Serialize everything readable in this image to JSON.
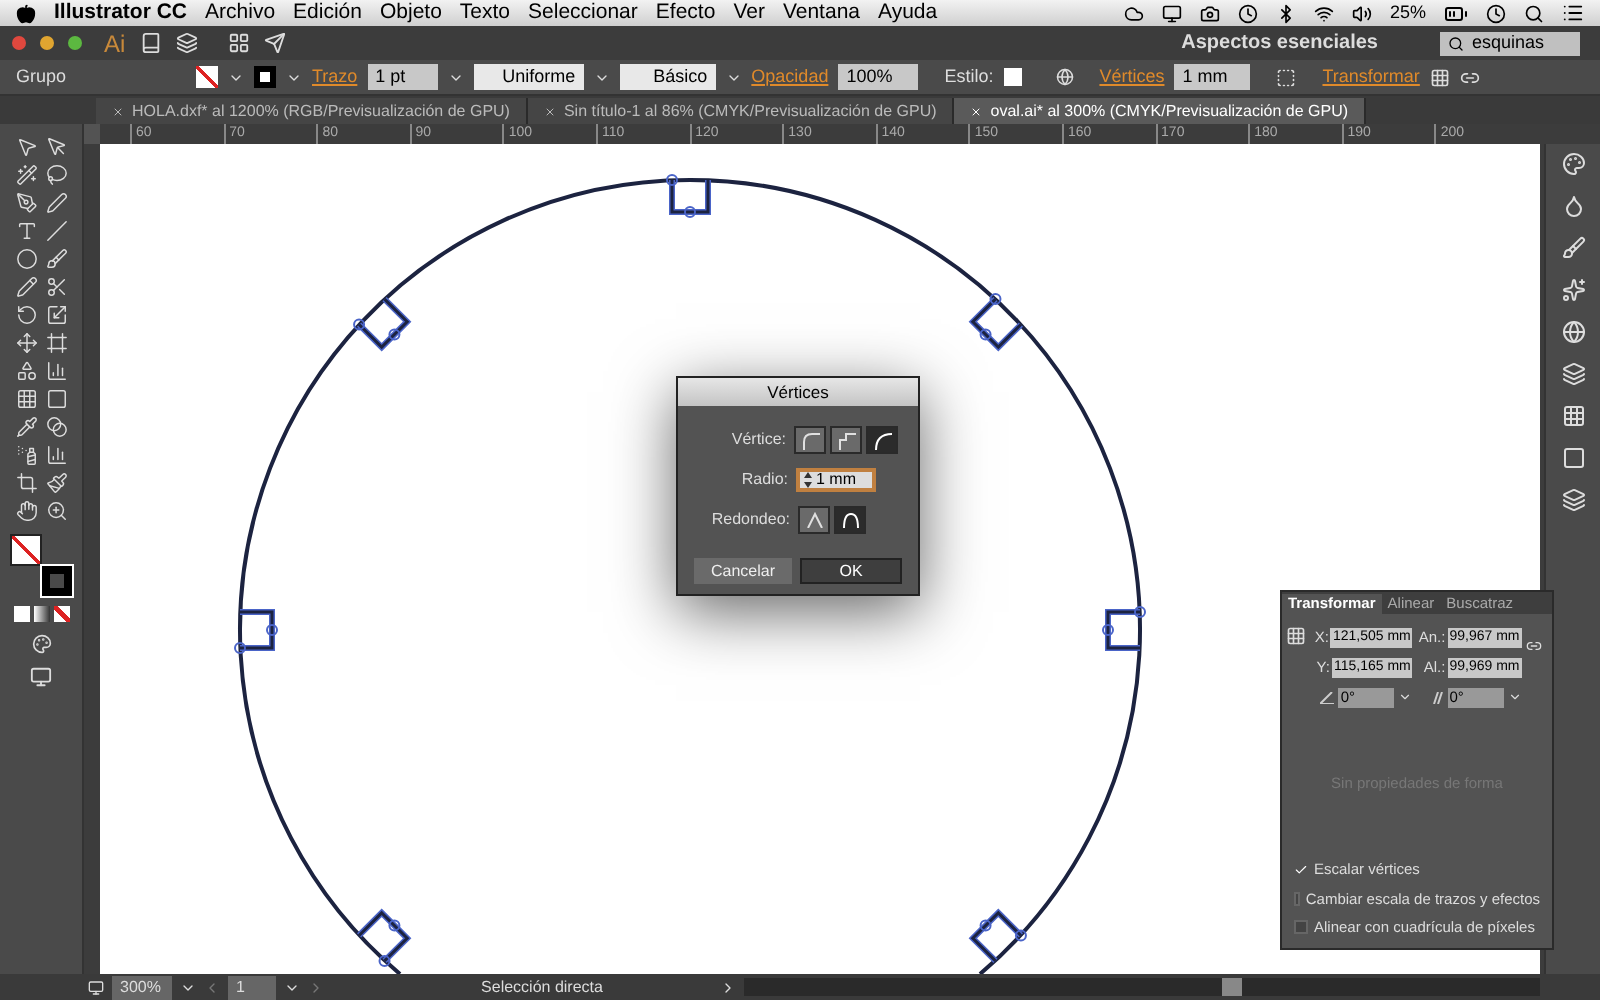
{
  "menu_bar": {
    "app": "Illustrator CC",
    "items": [
      "Archivo",
      "Edición",
      "Objeto",
      "Texto",
      "Seleccionar",
      "Efecto",
      "Ver",
      "Ventana",
      "Ayuda"
    ],
    "battery": "25%"
  },
  "app_bar": {
    "logo": "Ai",
    "workspace": "Aspectos esenciales",
    "search": {
      "value": "esquinas"
    }
  },
  "control_bar": {
    "selection": "Grupo",
    "stroke_label": "Trazo",
    "stroke_weight": "1 pt",
    "profile": "Uniforme",
    "brush": "Básico",
    "opacity_label": "Opacidad",
    "opacity": "100%",
    "style_label": "Estilo:",
    "corners_label": "Vértices",
    "corners": "1 mm",
    "transform_label": "Transformar"
  },
  "tabs": [
    {
      "label": "HOLA.dxf* al 1200% (RGB/Previsualización de GPU)",
      "selected": false
    },
    {
      "label": "Sin título-1 al 86% (CMYK/Previsualización de GPU)",
      "selected": false
    },
    {
      "label": "oval.ai* al 300% (CMYK/Previsualización de GPU)",
      "selected": true
    }
  ],
  "ruler_ticks": [
    "60",
    "70",
    "80",
    "90",
    "100",
    "110",
    "120",
    "130",
    "140",
    "150",
    "160",
    "170",
    "180",
    "190",
    "200"
  ],
  "dialog": {
    "title": "Vértices",
    "corner_label": "Vértice:",
    "corner_types": [
      {
        "selected": false
      },
      {
        "selected": false
      },
      {
        "selected": true
      }
    ],
    "radius_label": "Radio:",
    "radius": "1 mm",
    "rounding_label": "Redondeo:",
    "rounding_types": [
      {
        "selected": false
      },
      {
        "selected": true
      }
    ],
    "buttons": [
      {
        "label": "Cancelar",
        "kind": "secondary"
      },
      {
        "label": "OK",
        "kind": "primary"
      }
    ]
  },
  "transform_panel": {
    "tabs": [
      {
        "label": "Transformar",
        "selected": true
      },
      {
        "label": "Alinear",
        "selected": false
      },
      {
        "label": "Buscatraz",
        "selected": false
      }
    ],
    "fields": [
      {
        "label": "X:",
        "value": "121,505 mm"
      },
      {
        "label": "An.:",
        "value": "99,967 mm"
      },
      {
        "label": "Y:",
        "value": "115,165 mm"
      },
      {
        "label": "Al.:",
        "value": "99,969 mm"
      }
    ],
    "angle": "0°",
    "shear": "0°",
    "empty_message": "Sin propiedades de forma",
    "options": [
      {
        "label": "Escalar vértices",
        "checked": true
      },
      {
        "label": "Cambiar escala de trazos y efectos",
        "checked": false
      },
      {
        "label": "Alinear con cuadrícula de píxeles",
        "checked": false
      }
    ]
  },
  "status_bar": {
    "zoom": "300%",
    "artboard": "1",
    "tool": "Selección directa"
  }
}
